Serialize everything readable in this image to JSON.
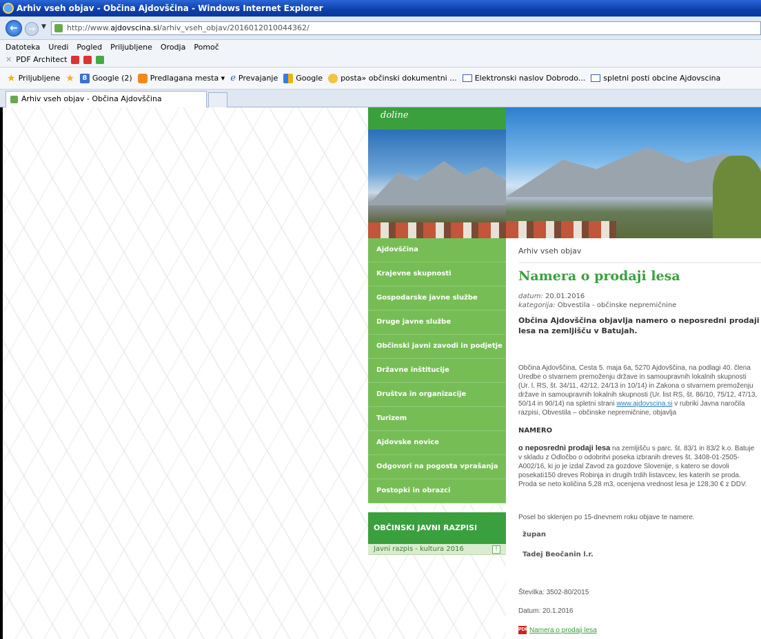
{
  "window": {
    "title": "Arhiv vseh objav - Občina Ajdovščina - Windows Internet Explorer"
  },
  "address": {
    "url_prefix": "http://www.",
    "url_domain": "ajdovscina.si",
    "url_path": "/arhiv_vseh_objav/2016012010044362/"
  },
  "menu": {
    "items": [
      "Datoteka",
      "Uredi",
      "Pogled",
      "Priljubljene",
      "Orodja",
      "Pomoč"
    ],
    "pdf_architect": "PDF Architect"
  },
  "favorites": {
    "label": "Priljubljene",
    "items": [
      {
        "label": "Google (2)",
        "icon": "google-icon"
      },
      {
        "label": "Predlagana mesta ▾",
        "icon": "suggested-sites-icon"
      },
      {
        "label": "Prevajanje",
        "icon": "translate-icon"
      },
      {
        "label": "Google",
        "icon": "google-color-icon"
      },
      {
        "label": "posta» občinski dokumentni ...",
        "icon": "mail-portal-icon"
      },
      {
        "label": "Elektronski naslov  Dobrodo...",
        "icon": "envelope-icon"
      },
      {
        "label": "spletni posti obcine Ajdovscina",
        "icon": "envelope-icon"
      }
    ]
  },
  "tab": {
    "title": "Arhiv vseh objav - Občina Ajdovščina"
  },
  "site": {
    "header_text": "doline",
    "nav": [
      "Ajdovščina",
      "Krajevne skupnosti",
      "Gospodarske javne službe",
      "Druge javne službe",
      "Občinski javni zavodi in podjetje",
      "Državne inštitucije",
      "Društva in organizacije",
      "Turizem",
      "Ajdovske novice",
      "Odgovori na pogosta vprašanja",
      "Postopki in obrazci"
    ],
    "razpisi_title": "OBČINSKI JAVNI RAZPISI",
    "razpisi_item": "Javni razpis - kultura 2016",
    "razpisi_more": "!"
  },
  "article": {
    "breadcrumb": "Arhiv vseh objav",
    "title": "Namera o prodaji lesa",
    "datum_label": "datum:",
    "datum_value": " 20.01.2016",
    "kategorija_label": "kategorija:",
    "kategorija_value": " Obvestila - občinske nepremičnine",
    "lead": "Občina Ajdovščina objavlja namero o neposredni prodaji lesa na zemljišču v Batujah.",
    "body_lines": [
      "Občina Ajdovščina, Cesta 5. maja 6a, 5270 Ajdovščina, na podlagi 40. člena",
      "Uredbe o stvarnem premoženju države in samoupravnih lokalnih skupnosti",
      "(Ur. l. RS, št. 34/11, 42/12, 24/13 in 10/14) in Zakona o stvarnem premoženju",
      "države in samoupravnih lokalnih skupnosti (Ur. list RS, št. 86/10, 75/12, 47/13,",
      "50/14 in 90/14) na spletni strani "
    ],
    "body_link": "www.ajdovscina.si",
    "body_after_link": " v rubriki Javna naročila",
    "body_last": "razpisi, Obvestila – občinske nepremičnine, objavlja",
    "namero": "NAMERO",
    "body2_bold": "o neposredni prodaji lesa",
    "body2_first": " na zemljišču s parc. št. 83/1 in 83/2 k.o. Batuje",
    "body2_lines": [
      "v skladu z Odločbo o odobritvi poseka izbranih dreves št. 3408-01-2505-",
      "A002/16, ki jo je izdal Zavod za gozdove Slovenije, s katero se dovoli",
      "posekati150 dreves Robinja in drugih trdih listavcev, les katerih se proda.",
      "Proda se neto količina 5,28 m3, ocenjena vrednost lesa je 128,30 € z DDV."
    ],
    "posel": "Posel bo sklenjen po 15-dnevnem roku objave te namere.",
    "zupan": "župan",
    "podpis": "Tadej Beočanin l.r.",
    "stevilka": "Številka: 3502-80/2015",
    "datum2": "Datum:  20.1.2016",
    "pdf_link": "Namera o prodaji lesa"
  }
}
